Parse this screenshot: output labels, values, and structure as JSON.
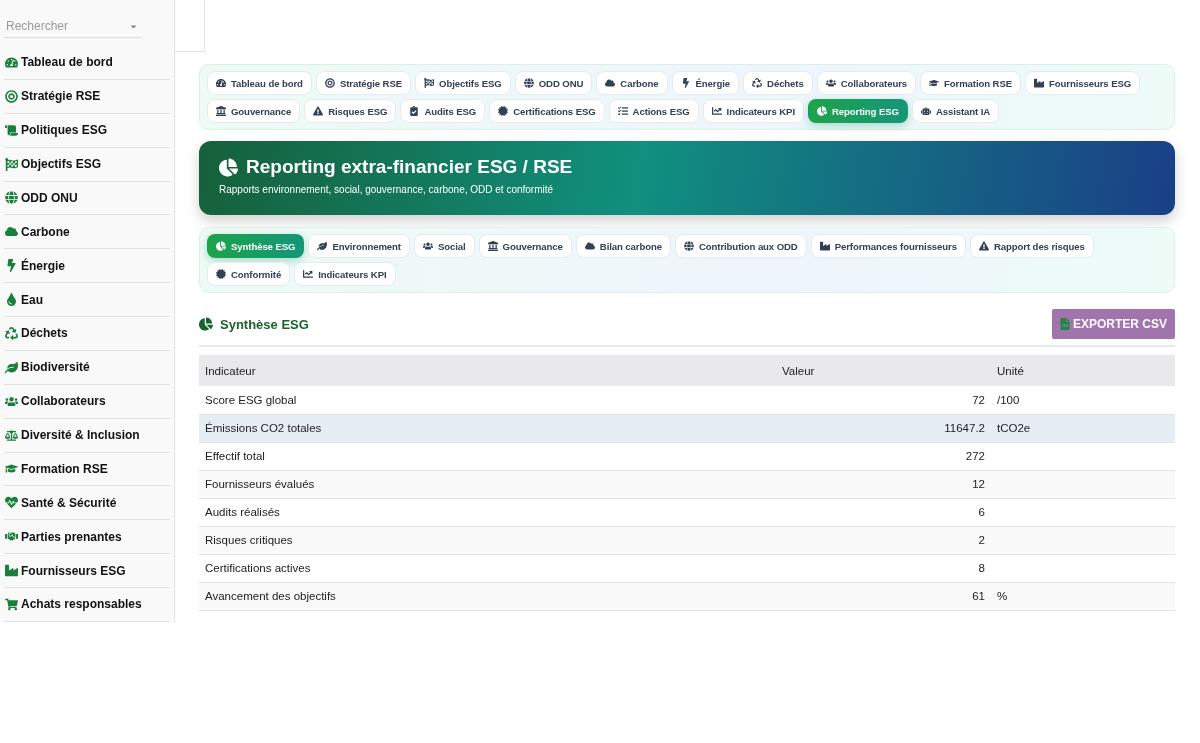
{
  "sidebar": {
    "search": {
      "placeholder": "Rechercher"
    },
    "items": [
      {
        "label": "Tableau de bord"
      },
      {
        "label": "Stratégie RSE"
      },
      {
        "label": "Politiques ESG"
      },
      {
        "label": "Objectifs ESG"
      },
      {
        "label": "ODD ONU"
      },
      {
        "label": "Carbone"
      },
      {
        "label": "Énergie"
      },
      {
        "label": "Eau"
      },
      {
        "label": "Déchets"
      },
      {
        "label": "Biodiversité"
      },
      {
        "label": "Collaborateurs"
      },
      {
        "label": "Diversité & Inclusion"
      },
      {
        "label": "Formation RSE"
      },
      {
        "label": "Santé & Sécurité"
      },
      {
        "label": "Parties prenantes"
      },
      {
        "label": "Fournisseurs ESG"
      },
      {
        "label": "Achats responsables"
      }
    ]
  },
  "nav_tabs": [
    {
      "label": "Tableau de bord",
      "selected": false
    },
    {
      "label": "Stratégie RSE",
      "selected": false
    },
    {
      "label": "Objectifs ESG",
      "selected": false
    },
    {
      "label": "ODD ONU",
      "selected": false
    },
    {
      "label": "Carbone",
      "selected": false
    },
    {
      "label": "Énergie",
      "selected": false
    },
    {
      "label": "Déchets",
      "selected": false
    },
    {
      "label": "Collaborateurs",
      "selected": false
    },
    {
      "label": "Formation RSE",
      "selected": false
    },
    {
      "label": "Fournisseurs ESG",
      "selected": false
    },
    {
      "label": "Gouvernance",
      "selected": false
    },
    {
      "label": "Risques ESG",
      "selected": false
    },
    {
      "label": "Audits ESG",
      "selected": false
    },
    {
      "label": "Certifications ESG",
      "selected": false
    },
    {
      "label": "Actions ESG",
      "selected": false
    },
    {
      "label": "Indicateurs KPI",
      "selected": false
    },
    {
      "label": "Reporting ESG",
      "selected": true
    },
    {
      "label": "Assistant IA",
      "selected": false
    }
  ],
  "hero": {
    "title": "Reporting extra-financier ESG / RSE",
    "subtitle": "Rapports environnement, social, gouvernance, carbone, ODD et conformité"
  },
  "report_tabs": [
    {
      "label": "Synthèse ESG",
      "selected": true
    },
    {
      "label": "Environnement",
      "selected": false
    },
    {
      "label": "Social",
      "selected": false
    },
    {
      "label": "Gouvernance",
      "selected": false
    },
    {
      "label": "Bilan carbone",
      "selected": false
    },
    {
      "label": "Contribution aux ODD",
      "selected": false
    },
    {
      "label": "Performances fournisseurs",
      "selected": false
    },
    {
      "label": "Rapport des risques",
      "selected": false
    },
    {
      "label": "Conformité",
      "selected": false
    },
    {
      "label": "Indicateurs KPI",
      "selected": false
    }
  ],
  "section": {
    "title": "Synthèse ESG",
    "export_button": "EXPORTER CSV"
  },
  "table": {
    "columns": [
      "Indicateur",
      "Valeur",
      "Unité"
    ],
    "rows": [
      {
        "indicator": "Score ESG global",
        "value": "72",
        "unit": "/100",
        "selected": false
      },
      {
        "indicator": "Émissions CO2 totales",
        "value": "11647.2",
        "unit": "tCO2e",
        "selected": true
      },
      {
        "indicator": "Effectif total",
        "value": "272",
        "selected": false
      },
      {
        "indicator": "Fournisseurs évalués",
        "value": "12",
        "selected": false
      },
      {
        "indicator": "Audits réalisés",
        "value": "6",
        "selected": false
      },
      {
        "indicator": "Risques critiques",
        "value": "2",
        "selected": false
      },
      {
        "indicator": "Certifications actives",
        "value": "8",
        "selected": false
      },
      {
        "indicator": "Avancement des objectifs",
        "value": "61",
        "unit": "%",
        "selected": false
      }
    ]
  }
}
